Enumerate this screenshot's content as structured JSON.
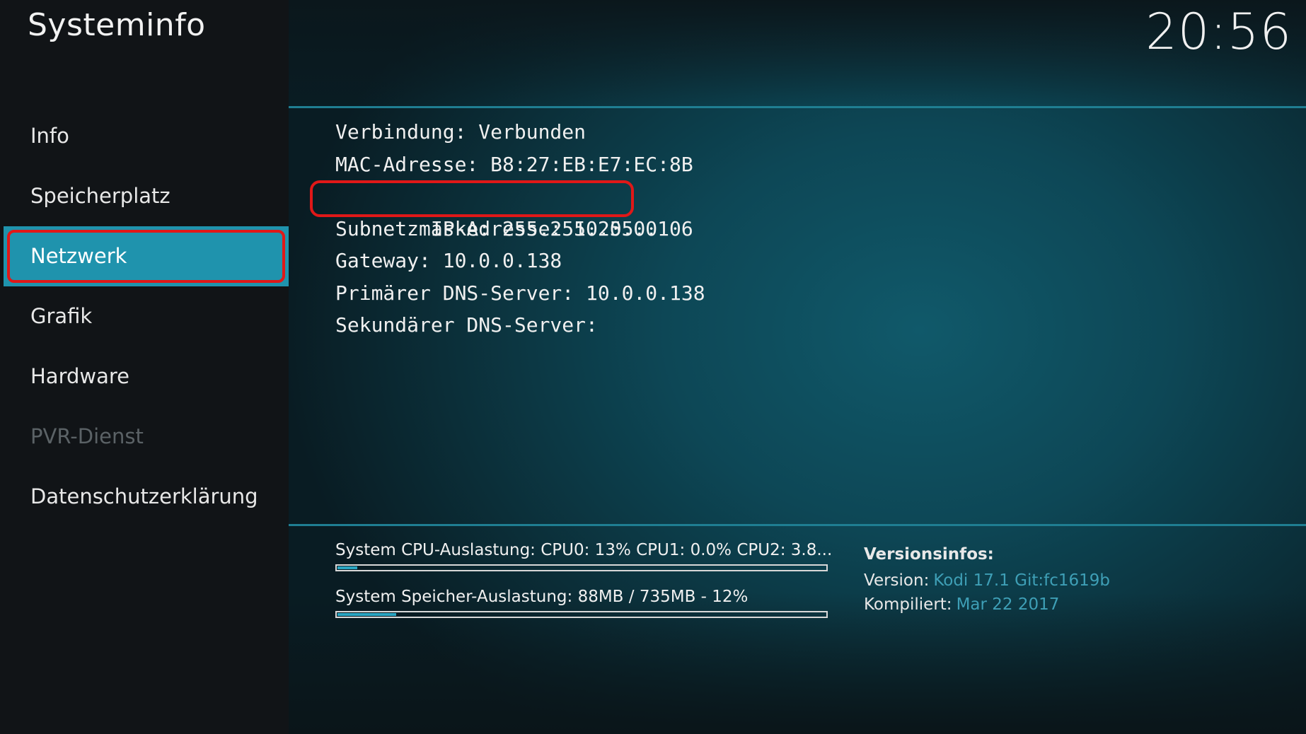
{
  "app": {
    "title": "Systeminfo",
    "clock": "20:56"
  },
  "sidebar": {
    "items": [
      {
        "label": "Info",
        "state": "normal"
      },
      {
        "label": "Speicherplatz",
        "state": "normal"
      },
      {
        "label": "Netzwerk",
        "state": "active"
      },
      {
        "label": "Grafik",
        "state": "normal"
      },
      {
        "label": "Hardware",
        "state": "normal"
      },
      {
        "label": "PVR-Dienst",
        "state": "disabled"
      },
      {
        "label": "Datenschutzerklärung",
        "state": "normal"
      }
    ]
  },
  "network": {
    "rows": [
      "Verbindung: Verbunden",
      "MAC-Adresse: B8:27:EB:E7:EC:8B",
      "IP-Adresse: 10.0.0.106",
      "Subnetzmaske: 255.255.255.0",
      "Gateway: 10.0.0.138",
      "Primärer DNS-Server: 10.0.0.138",
      "Sekundärer DNS-Server:"
    ]
  },
  "stats": {
    "cpu_label": "System CPU-Auslastung: CPU0:  13% CPU1: 0.0% CPU2: 3.8...",
    "cpu_fraction": 0.04,
    "memory_label": "System Speicher-Auslastung: 88MB / 735MB - 12%",
    "memory_fraction": 0.12
  },
  "version_info": {
    "heading": "Versionsinfos:",
    "version_label": "Version:",
    "version_value": "Kodi 17.1 Git:fc1619b",
    "compiled_label": "Kompiliert:",
    "compiled_value": "Mar 22 2017"
  },
  "colors": {
    "accent": "#1f93ad",
    "highlight_ring": "#e01818",
    "version_value": "#3e9fb6"
  }
}
